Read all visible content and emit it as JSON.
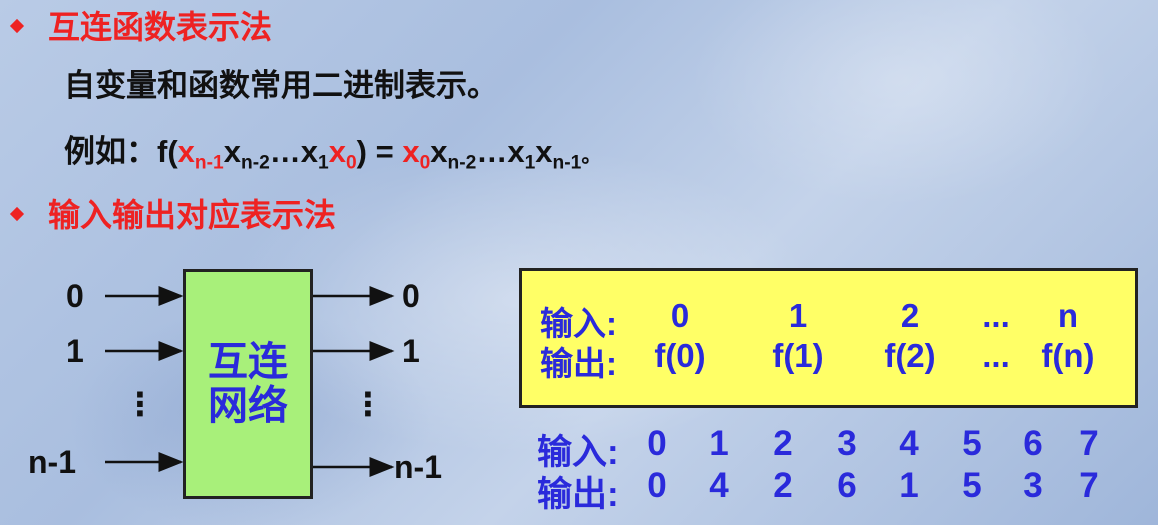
{
  "bullets": {
    "b1": "互连函数表示法",
    "line2": "自变量和函数常用二进制表示。",
    "example_prefix": "例如：f(",
    "b2": "输入输出对应表示法"
  },
  "example": {
    "x": "x",
    "sub_n1": "n-1",
    "sub_n2": "n-2",
    "dots": "…",
    "sub_1": "1",
    "sub_0": "0",
    "close_eq": ") = ",
    "end": "。"
  },
  "diagram": {
    "inputs": [
      "0",
      "1",
      "⋮",
      "n-1"
    ],
    "outputs": [
      "0",
      "1",
      "⋮",
      "n-1"
    ],
    "box_label": "互连\n网络"
  },
  "table_general": {
    "input_label": "输入:",
    "output_label": "输出:",
    "inputs": [
      "0",
      "1",
      "2",
      "...",
      "n"
    ],
    "outputs": [
      "f(0)",
      "f(1)",
      "f(2)",
      "...",
      "f(n)"
    ]
  },
  "table_example": {
    "input_label": "输入:",
    "output_label": "输出:",
    "inputs": [
      "0",
      "1",
      "2",
      "3",
      "4",
      "5",
      "6",
      "7"
    ],
    "outputs": [
      "0",
      "4",
      "2",
      "6",
      "1",
      "5",
      "3",
      "7"
    ]
  },
  "colors": {
    "red": "#ee2222",
    "blue": "#2a2adb",
    "green_box": "#a8f07a",
    "yellow_box": "#ffff66"
  }
}
